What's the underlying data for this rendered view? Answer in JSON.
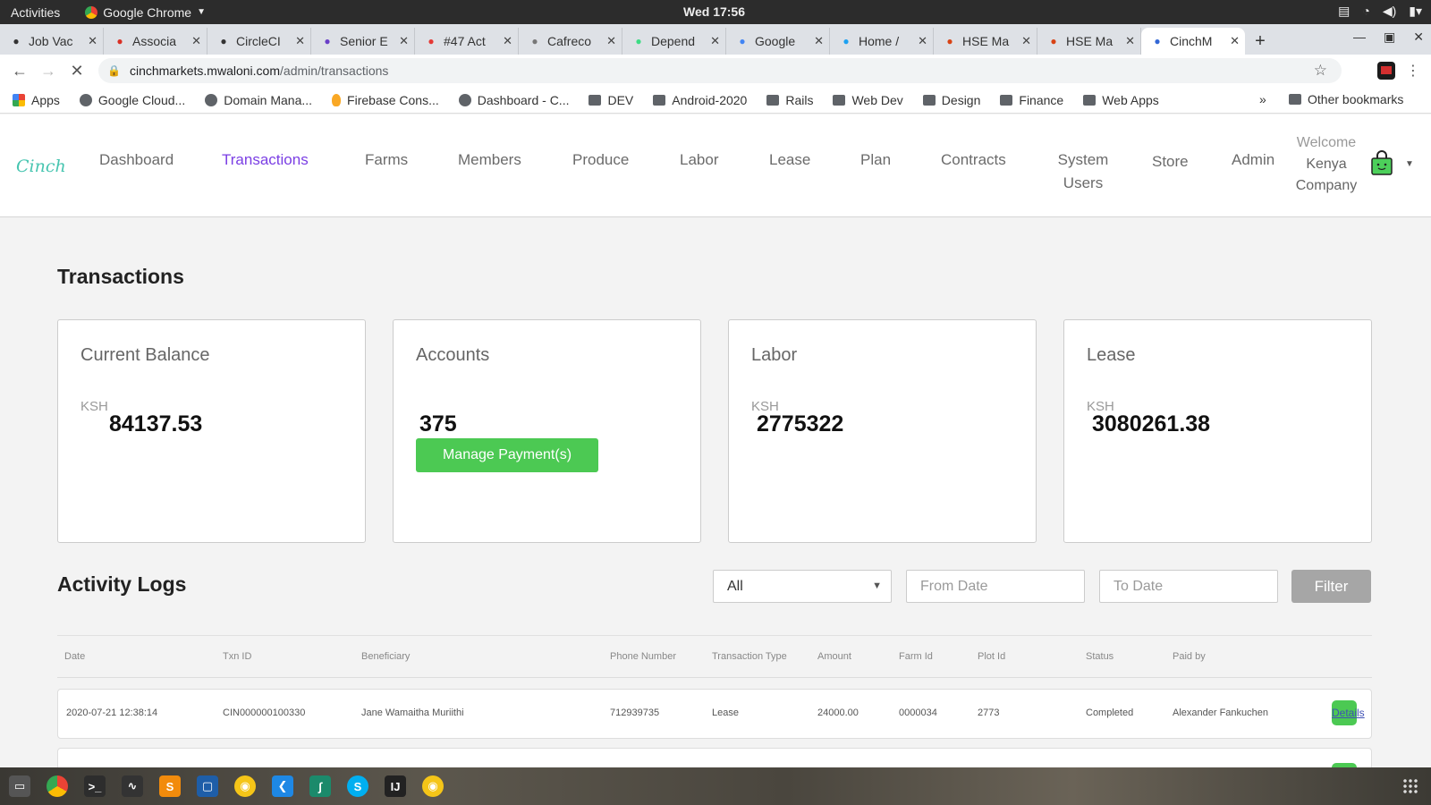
{
  "system": {
    "activities": "Activities",
    "app_name": "Google Chrome",
    "clock": "Wed 17:56"
  },
  "tabs": [
    {
      "title": "Job Vac",
      "icon": "star-icon",
      "color": "#333333"
    },
    {
      "title": "Associa",
      "icon": "gmail-icon",
      "color": "#d93025"
    },
    {
      "title": "CircleCI",
      "icon": "circleci-icon",
      "color": "#343434"
    },
    {
      "title": "Senior E",
      "icon": "gear-icon",
      "color": "#6a3fc8"
    },
    {
      "title": "#47 Act",
      "icon": "chart-icon",
      "color": "#e53935"
    },
    {
      "title": "Cafreco",
      "icon": "arrow-icon",
      "color": "#777777"
    },
    {
      "title": "Depend",
      "icon": "android-icon",
      "color": "#3ddc84"
    },
    {
      "title": "Google",
      "icon": "google-icon",
      "color": "#4285f4"
    },
    {
      "title": "Home /",
      "icon": "twitter-icon",
      "color": "#1da1f2"
    },
    {
      "title": "HSE Ma",
      "icon": "cube-icon",
      "color": "#d84315"
    },
    {
      "title": "HSE Ma",
      "icon": "cube-icon",
      "color": "#d84315"
    },
    {
      "title": "CinchM",
      "icon": "loading-icon",
      "color": "#3367d6",
      "active": true
    }
  ],
  "address": {
    "domain": "cinchmarkets.mwaloni.com",
    "path": "/admin/transactions"
  },
  "bookmarks": [
    {
      "label": "Apps",
      "icon": "apps"
    },
    {
      "label": "Google Cloud...",
      "icon": "globe"
    },
    {
      "label": "Domain Mana...",
      "icon": "globe"
    },
    {
      "label": "Firebase Cons...",
      "icon": "fire"
    },
    {
      "label": "Dashboard - C...",
      "icon": "globe"
    },
    {
      "label": "DEV",
      "icon": "folder"
    },
    {
      "label": "Android-2020",
      "icon": "folder"
    },
    {
      "label": "Rails",
      "icon": "folder"
    },
    {
      "label": "Web Dev",
      "icon": "folder"
    },
    {
      "label": "Design",
      "icon": "folder"
    },
    {
      "label": "Finance",
      "icon": "folder"
    },
    {
      "label": "Web Apps",
      "icon": "folder"
    }
  ],
  "bookmarks_more": "»",
  "bookmarks_other": "Other bookmarks",
  "app": {
    "logo": "Cinch",
    "nav": [
      "Dashboard",
      "Transactions",
      "Farms",
      "Members",
      "Produce",
      "Labor",
      "Lease",
      "Plan",
      "Contracts",
      "System Users",
      "Store",
      "Admin"
    ],
    "active_nav": "Transactions",
    "welcome": "Welcome",
    "user": "Kenya Company"
  },
  "page_title": "Transactions",
  "cards": [
    {
      "title": "Current Balance",
      "currency": "KSH",
      "amount": "84137.53"
    },
    {
      "title": "Accounts",
      "currency": "",
      "amount": "375",
      "button": "Manage Payment(s)"
    },
    {
      "title": "Labor",
      "currency": "KSH",
      "amount": "2775322"
    },
    {
      "title": "Lease",
      "currency": "KSH",
      "amount": "3080261.38"
    }
  ],
  "activity": {
    "title": "Activity Logs",
    "select_value": "All",
    "from_placeholder": "From Date",
    "to_placeholder": "To Date",
    "filter_label": "Filter",
    "columns": [
      "Date",
      "Txn ID",
      "Beneficiary",
      "Phone Number",
      "Transaction Type",
      "Amount",
      "Farm Id",
      "Plot Id",
      "Status",
      "Paid by"
    ],
    "rows": [
      {
        "date": "2020-07-21 12:38:14",
        "txn_id": "CIN000000100330",
        "beneficiary": "Jane Wamaitha Muriithi",
        "phone": "712939735",
        "type": "Lease",
        "amount": "24000.00",
        "farm_id": "0000034",
        "plot_id": "2773",
        "status": "Completed",
        "paid_by": "Alexander Fankuchen",
        "action": "Details"
      }
    ]
  },
  "colors": {
    "accent": "#7b3fe4",
    "green": "#4cc953",
    "logo": "#47c5b0",
    "filter": "#a6a6a6"
  }
}
